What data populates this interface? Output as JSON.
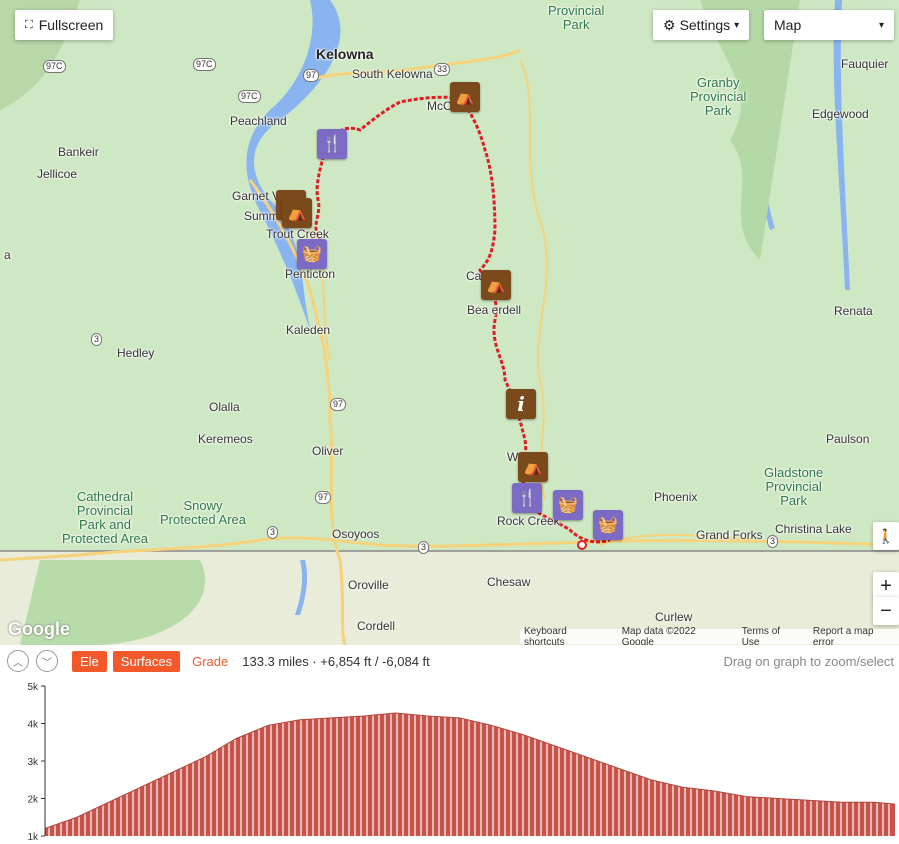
{
  "map": {
    "fullscreen_label": "Fullscreen",
    "settings_label": "Settings",
    "map_type": "Map",
    "zoom_in": "+",
    "zoom_out": "−",
    "google_logo": "Google",
    "attribution": [
      "Keyboard shortcuts",
      "Map data ©2022 Google",
      "Terms of Use",
      "Report a map error"
    ],
    "labels": {
      "kelowna": "Kelowna",
      "south_kelowna": "South Kelowna",
      "peachland": "Peachland",
      "bankeir": "Bankeir",
      "jellicoe": "Jellicoe",
      "garnet": "Garnet V",
      "summerland": "Summ",
      "trout_creek": "Trout Creek",
      "penticton": "Penticton",
      "kaleden": "Kaleden",
      "hedley": "Hedley",
      "olalla": "Olalla",
      "keremeos": "Keremeos",
      "oliver": "Oliver",
      "osoyoos": "Osoyoos",
      "oroville": "Oroville",
      "cordell": "Cordell",
      "chesaw": "Chesaw",
      "curlew": "Curlew",
      "rock_creek": "Rock Creek",
      "westbridge": "We     dge",
      "carmi": "Ca",
      "beaverdell": "Bea   erdell",
      "mcculloch": "McC",
      "phoenix": "Phoenix",
      "grand_forks": "Grand Forks",
      "christina_lake": "Christina Lake",
      "fauquier": "Fauquier",
      "edgewood": "Edgewood",
      "renata": "Renata",
      "paulson": "Paulson",
      "a_edge": "a"
    },
    "parks": {
      "granby": "Granby\nProvincial\nPark",
      "provincial_top": "Provincial\nPark",
      "gladstone": "Gladstone\nProvincial\nPark",
      "cathedral": "Cathedral\nProvincial\nPark and\nProtected Area",
      "snowy": "Snowy\nProtected Area"
    },
    "shields": [
      "97C",
      "97C",
      "97C",
      "97",
      "33",
      "3",
      "97",
      "97",
      "3",
      "3",
      "3"
    ]
  },
  "toolbar": {
    "ele": "Ele",
    "surfaces": "Surfaces",
    "grade": "Grade",
    "stats": "133.3 miles · +6,854 ft / -6,084 ft",
    "hint": "Drag on graph to zoom/select"
  },
  "chart_data": {
    "type": "area",
    "title": "",
    "xlabel": "",
    "ylabel": "",
    "ylim": [
      1000,
      5000
    ],
    "y_ticks": [
      "5k",
      "4k",
      "3k",
      "2k",
      "1k"
    ],
    "x": [
      0,
      5,
      10,
      15,
      20,
      25,
      30,
      35,
      40,
      45,
      50,
      55,
      60,
      65,
      70,
      75,
      80,
      85,
      90,
      95,
      100,
      105,
      110,
      115,
      120,
      125,
      130,
      133.3
    ],
    "values": [
      1200,
      1500,
      1900,
      2300,
      2700,
      3100,
      3600,
      3950,
      4100,
      4150,
      4200,
      4280,
      4200,
      4150,
      3950,
      3700,
      3400,
      3100,
      2800,
      2500,
      2300,
      2200,
      2050,
      2000,
      1950,
      1900,
      1900,
      1850
    ],
    "grid": false
  }
}
